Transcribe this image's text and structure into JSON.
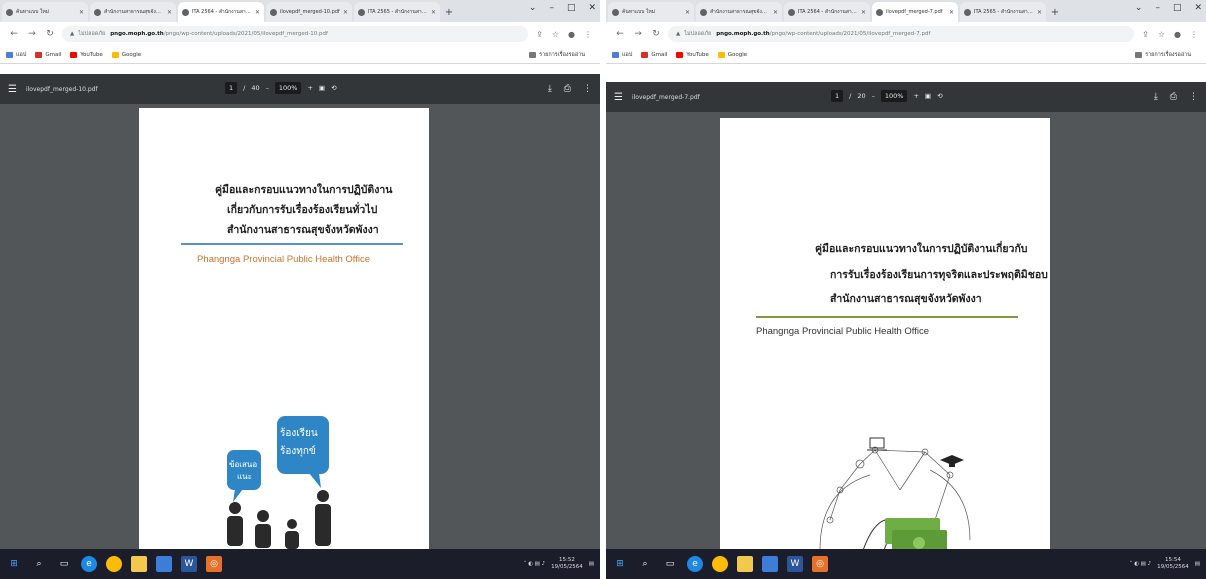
{
  "left": {
    "tabs": [
      {
        "label": "ค้นหาแบบ ใหม่",
        "active": false
      },
      {
        "label": "สำนักงานสาธารณสุขจังหวัดพังงา",
        "active": false
      },
      {
        "label": "ITA 2564 - สำนักงานสาธารณสุขจังหวัด",
        "active": true
      },
      {
        "label": "ilovepdf_merged-10.pdf",
        "active": false
      },
      {
        "label": "ITA 2565 - สำนักงานสาธารณสุขจังหวัด",
        "active": false
      }
    ],
    "address": {
      "secure": "ไม่ปลอดภัย",
      "host": "pngo.moph.go.th",
      "path": "/pngo/wp-content/uploads/2021/05/ilovepdf_merged-10.pdf"
    },
    "bookmarks": [
      "แอป",
      "Gmail",
      "YouTube",
      "Google"
    ],
    "reading_list": "รายการเรื่องรออ่าน",
    "pdf": {
      "filename": "ilovepdf_merged-10.pdf",
      "page_current": "1",
      "page_total": "40",
      "zoom": "100%",
      "title_lines": [
        "คู่มือและกรอบแนวทางในการปฏิบัติงาน",
        "เกี่ยวกับการรับเรื่องร้องเรียนทั่วไป",
        "สำนักงานสาธารณสุขจังหวัดพังงา"
      ],
      "org_name": "Phangnga Provincial Public Health Office",
      "bubble_left": [
        "ข้อเสนอ",
        "แนะ"
      ],
      "bubble_right": [
        "ร้องเรียน",
        "ร้องทุกข์"
      ]
    },
    "clock": {
      "time": "15:52",
      "date": "19/05/2564"
    },
    "colors": {
      "accent_line": "#5b8fcf",
      "org_text": "#c8742a",
      "bubble": "#2f86c6"
    }
  },
  "right": {
    "tabs": [
      {
        "label": "ค้นหาแบบ ใหม่",
        "active": false
      },
      {
        "label": "สำนักงานสาธารณสุขจังหวัดพังงา",
        "active": false
      },
      {
        "label": "ITA 2564 - สำนักงานสาธารณสุขจังหวัด",
        "active": false
      },
      {
        "label": "ilovepdf_merged-7.pdf",
        "active": true
      },
      {
        "label": "ITA 2565 - สำนักงานสาธารณสุขจังหวัด",
        "active": false
      }
    ],
    "address": {
      "secure": "ไม่ปลอดภัย",
      "host": "pngo.moph.go.th",
      "path": "/pngo/wp-content/uploads/2021/05/ilovepdf_merged-7.pdf"
    },
    "bookmarks": [
      "แอป",
      "Gmail",
      "YouTube",
      "Google"
    ],
    "reading_list": "รายการเรื่องรออ่าน",
    "pdf": {
      "filename": "ilovepdf_merged-7.pdf",
      "page_current": "1",
      "page_total": "20",
      "zoom": "100%",
      "title_lines": [
        "คู่มือและกรอบแนวทางในการปฏิบัติงานเกี่ยวกับ",
        "การรับเรื่องร้องเรียนการทุจริตและประพฤติมิชอบ",
        "สำนักงานสาธารณสุขจังหวัดพังงา"
      ],
      "org_name": "Phangnga Provincial Public Health Office"
    },
    "clock": {
      "time": "15:54",
      "date": "19/05/2564"
    },
    "colors": {
      "accent_line": "#7f9a3a",
      "org_text": "#333333",
      "money": "#6fae44"
    }
  }
}
